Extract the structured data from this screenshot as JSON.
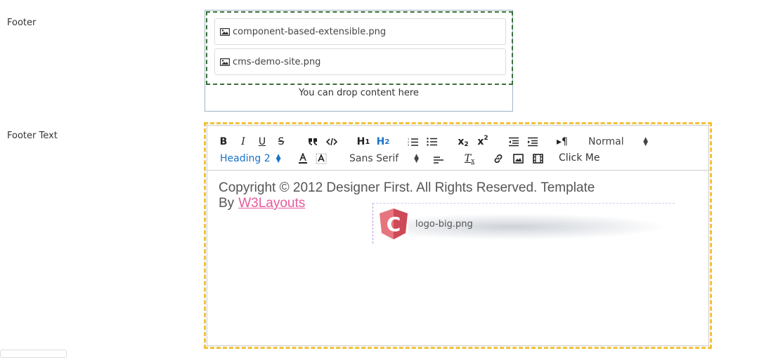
{
  "fields": {
    "footer_label": "Footer",
    "footer_text_label": "Footer Text"
  },
  "dropzone": {
    "files": [
      {
        "name": "component-based-extensible.png"
      },
      {
        "name": "cms-demo-site.png"
      }
    ],
    "hint": "You can drop content here"
  },
  "editor": {
    "toolbar": {
      "size_picker": "Normal",
      "header_picker": "Heading 2",
      "font_picker": "Sans Serif",
      "custom_button": "Click Me"
    },
    "content": {
      "text": "Copyright © 2012 Designer First. All Rights Reserved. Template By",
      "link_text": "W3Layouts"
    },
    "drag_ghost": {
      "file_name": "logo-big.png"
    }
  },
  "colors": {
    "dropzone_border": "#3b6e3b",
    "editor_border": "#f2c23a",
    "link": "#e75b9e",
    "active_blue": "#1a73c7"
  }
}
